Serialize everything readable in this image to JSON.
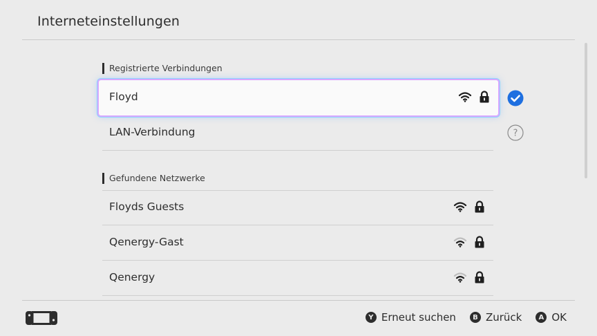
{
  "header": {
    "title": "Interneteinstellungen"
  },
  "registered": {
    "label": "Registrierte Verbindungen",
    "items": [
      {
        "name": "Floyd",
        "signal": "strong",
        "locked": true,
        "status": "connected"
      },
      {
        "name": "LAN-Verbindung",
        "status": "help"
      }
    ]
  },
  "found": {
    "label": "Gefundene Netzwerke",
    "items": [
      {
        "name": "Floyds Guests",
        "signal": "strong",
        "locked": true
      },
      {
        "name": "Qenergy-Gast",
        "signal": "medium",
        "locked": true
      },
      {
        "name": "Qenergy",
        "signal": "medium",
        "locked": true
      }
    ]
  },
  "footer": {
    "actions": [
      {
        "button": "Y",
        "label": "Erneut suchen"
      },
      {
        "button": "B",
        "label": "Zurück"
      },
      {
        "button": "A",
        "label": "OK"
      }
    ]
  },
  "colors": {
    "accent": "#1e6fe0",
    "background": "#ebebeb",
    "text": "#2d2d2d"
  },
  "icons": {
    "wifi": "wifi-icon",
    "lock": "lock-icon",
    "check": "check-circle-icon",
    "help": "help-circle-icon",
    "console": "console-icon"
  }
}
